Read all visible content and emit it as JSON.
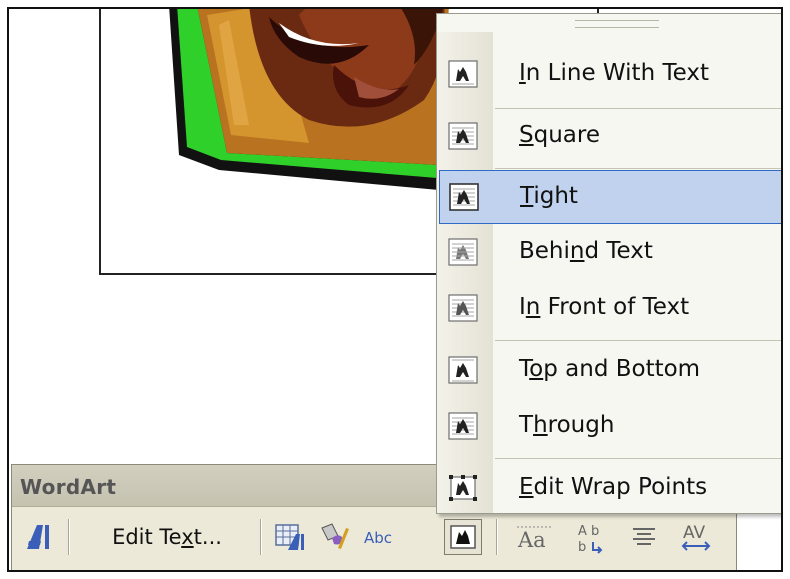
{
  "toolbar": {
    "title": "WordArt",
    "buttons": {
      "insert_wordart_icon": "wordart-insert-icon",
      "edit_text_label": "Edit Text...",
      "edit_text_mnemonic": "x",
      "gallery_icon": "wordart-gallery-icon",
      "format_icon": "format-wordart-icon",
      "shape_icon": "wordart-shape-icon",
      "text_wrapping_icon": "text-wrapping-icon",
      "same_letter_heights_icon": "same-letter-heights-icon",
      "vertical_text_icon": "vertical-text-icon",
      "alignment_icon": "alignment-icon",
      "char_spacing_icon": "character-spacing-icon"
    }
  },
  "wrap_menu": {
    "items": [
      {
        "pre": "",
        "mn": "I",
        "post": "n Line With Text",
        "icon": "in-line-with-text-icon",
        "selected": false
      },
      {
        "pre": "",
        "mn": "S",
        "post": "quare",
        "icon": "square-wrap-icon",
        "selected": false
      },
      {
        "pre": "",
        "mn": "T",
        "post": "ight",
        "icon": "tight-wrap-icon",
        "selected": true
      },
      {
        "pre": "Behi",
        "mn": "n",
        "post": "d Text",
        "icon": "behind-text-icon",
        "selected": false
      },
      {
        "pre": "I",
        "mn": "n",
        "post": " Front of Text",
        "icon": "in-front-of-text-icon",
        "selected": false
      },
      {
        "pre": "T",
        "mn": "o",
        "post": "p and Bottom",
        "icon": "top-and-bottom-icon",
        "selected": false
      },
      {
        "pre": "T",
        "mn": "h",
        "post": "rough",
        "icon": "through-wrap-icon",
        "selected": false
      },
      {
        "pre": "",
        "mn": "E",
        "post": "dit Wrap Points",
        "icon": "edit-wrap-points-icon",
        "selected": false
      }
    ]
  },
  "colors": {
    "highlight": "#c1d2ee",
    "highlight_border": "#316ac5",
    "toolbar_bg": "#ece9d8",
    "wordart_blue": "#3b5fb8"
  }
}
